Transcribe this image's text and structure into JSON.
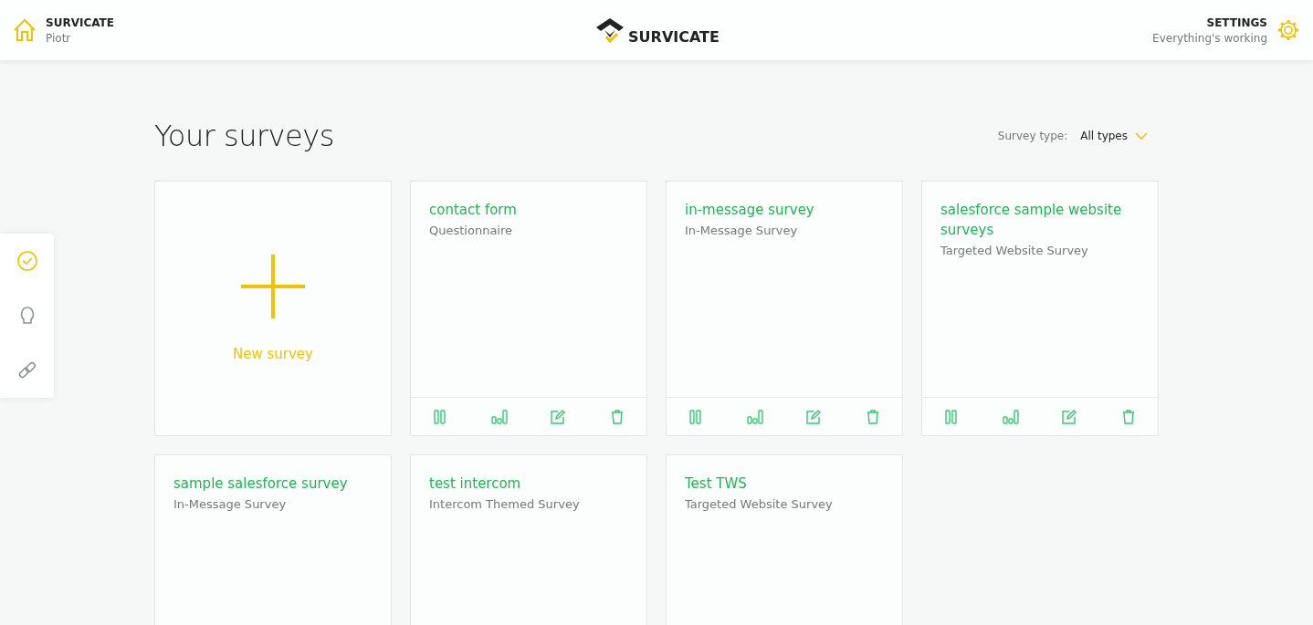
{
  "header": {
    "account": "SURVICATE",
    "user": "Piotr",
    "logo_text": "SURVICATE",
    "settings": "SETTINGS",
    "status": "Everything's working"
  },
  "side_rail": [
    {
      "kind": "check",
      "selected": true
    },
    {
      "kind": "bulb",
      "selected": false
    },
    {
      "kind": "link",
      "selected": false
    }
  ],
  "page_title": "Your surveys",
  "filter": {
    "label": "Survey type:",
    "value": "All types"
  },
  "new_survey": "New survey",
  "surveys": [
    {
      "title": "contact form",
      "type": "Questionnaire",
      "actions": [
        {
          "kind": "pause"
        },
        {
          "kind": "stats"
        },
        {
          "kind": "edit"
        },
        {
          "kind": "delete"
        }
      ]
    },
    {
      "title": "in-message survey",
      "type": "In-Message Survey",
      "actions": [
        {
          "kind": "pause"
        },
        {
          "kind": "stats"
        },
        {
          "kind": "edit"
        },
        {
          "kind": "delete"
        }
      ]
    },
    {
      "title": "salesforce sample website surveys",
      "type": "Targeted Website Survey",
      "actions": [
        {
          "kind": "pause"
        },
        {
          "kind": "stats"
        },
        {
          "kind": "edit"
        },
        {
          "kind": "delete"
        }
      ]
    },
    {
      "title": "sample salesforce survey",
      "type": "In-Message Survey"
    },
    {
      "title": "test intercom",
      "type": "Intercom Themed Survey"
    },
    {
      "title": "Test TWS",
      "type": "Targeted Website Survey"
    }
  ]
}
